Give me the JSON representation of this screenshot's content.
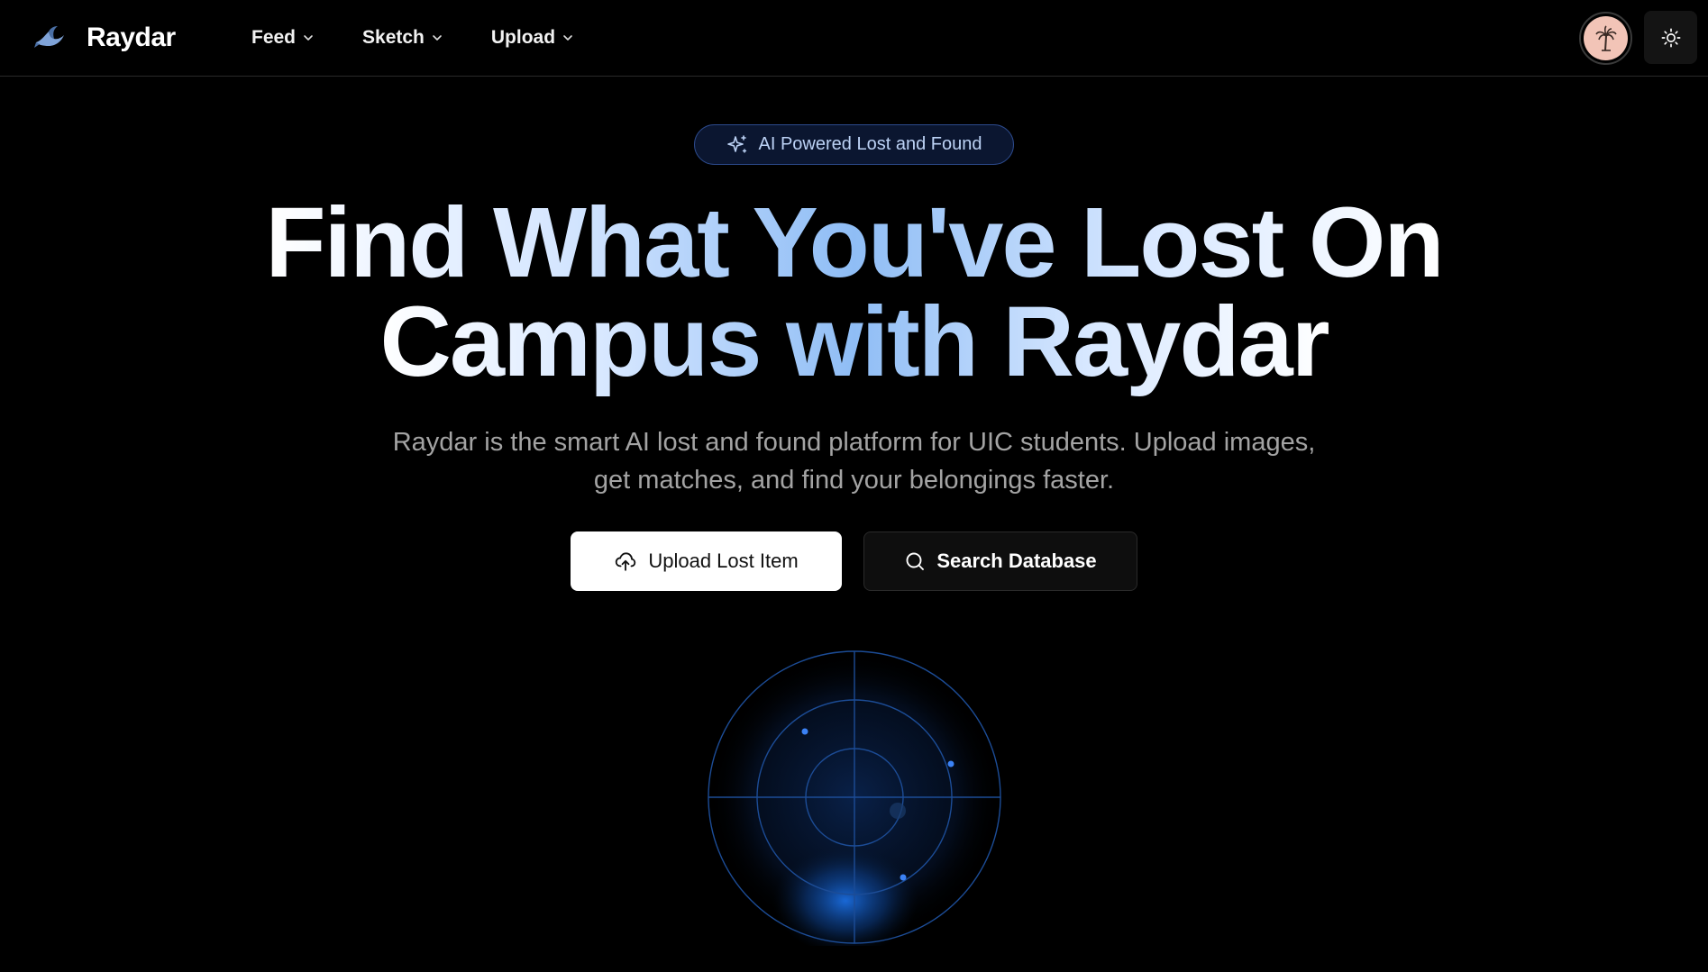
{
  "navbar": {
    "brand_name": "Raydar",
    "menu": [
      {
        "label": "Feed"
      },
      {
        "label": "Sketch"
      },
      {
        "label": "Upload"
      }
    ]
  },
  "hero": {
    "badge": "AI Powered Lost and Found",
    "headline_line1": "Find What You've Lost On",
    "headline_line2": "Campus with Raydar",
    "subtitle": "Raydar is the smart AI lost and found platform for UIC students. Upload images, get matches, and find your belongings faster.",
    "primary_button": "Upload Lost Item",
    "secondary_button": "Search Database"
  },
  "colors": {
    "background": "#000000",
    "accent_blue": "#3b82f6",
    "badge_border": "#2c4a8c",
    "avatar_bg": "#f2c4b7"
  },
  "icons": {
    "brand": "swallow-logo-icon",
    "theme_toggle": "sun-icon",
    "badge": "sparkles-icon",
    "upload": "cloud-upload-icon",
    "search": "search-icon"
  }
}
